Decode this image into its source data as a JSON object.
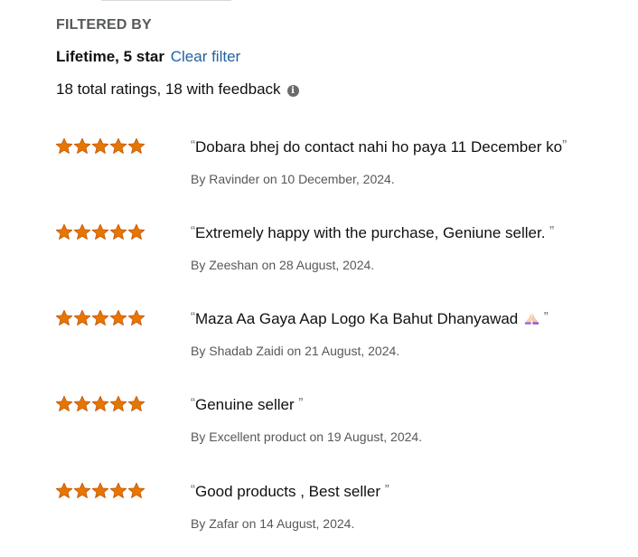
{
  "header": {
    "filtered_by_label": "FILTERED BY",
    "filter_value": "Lifetime, 5 star",
    "clear_filter_label": "Clear filter",
    "totals_text": "18 total ratings, 18 with feedback",
    "info_icon": "i"
  },
  "colors": {
    "star": "#e77600",
    "link": "#2162a1",
    "muted_text": "#565959"
  },
  "reviews": [
    {
      "rating": 5,
      "quote": "Dobara bhej do contact nahi ho paya 11 December ko",
      "byline": "By Ravinder on 10 December, 2024."
    },
    {
      "rating": 5,
      "quote": "Extremely happy with the purchase, Geniune seller.",
      "byline": "By Zeeshan on 28 August, 2024."
    },
    {
      "rating": 5,
      "quote": "Maza Aa Gaya Aap Logo Ka Bahut Dhanyawad",
      "emoji": "folded-hands-icon",
      "byline": "By Shadab Zaidi on 21 August, 2024."
    },
    {
      "rating": 5,
      "quote": "Genuine seller",
      "byline": "By Excellent product on 19 August, 2024."
    },
    {
      "rating": 5,
      "quote": "Good products , Best seller",
      "byline": "By Zafar on 14 August, 2024."
    }
  ]
}
